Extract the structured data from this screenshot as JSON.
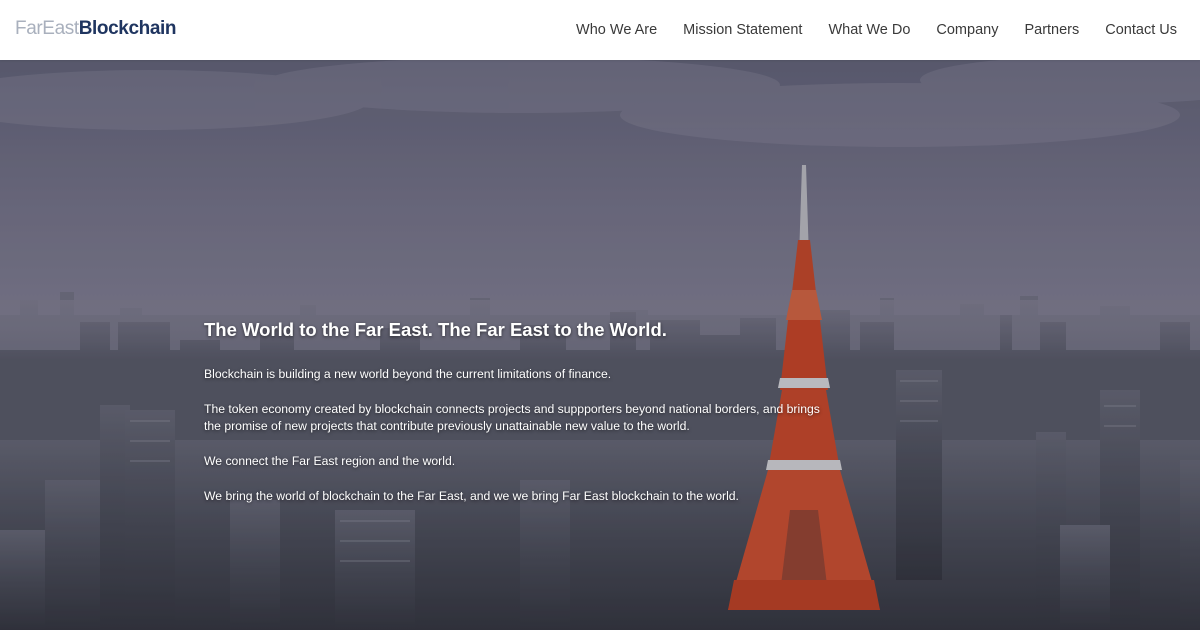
{
  "brand": {
    "logo_light": "FarEast",
    "logo_bold": "Blockchain"
  },
  "nav": {
    "items": [
      {
        "label": "Who We Are"
      },
      {
        "label": "Mission Statement"
      },
      {
        "label": "What We Do"
      },
      {
        "label": "Company"
      },
      {
        "label": "Partners"
      },
      {
        "label": "Contact Us"
      }
    ]
  },
  "hero": {
    "title": "The World to the Far East. The Far East to the World.",
    "paragraphs": [
      "Blockchain is building a new world beyond the current limitations of finance.",
      "The token economy created by blockchain connects projects and suppporters beyond national borders, and brings the promise of new projects that contribute previously unattainable new value to the world.",
      "We connect the Far East region and the world.",
      "We bring the world of blockchain to the Far East, and we we bring Far East blockchain to the world."
    ]
  },
  "colors": {
    "logo_light": "#a9b0bd",
    "logo_bold": "#1f3560",
    "nav_text": "#3a3a3a",
    "tower_red": "#e2471f",
    "hero_text": "#ffffff"
  }
}
